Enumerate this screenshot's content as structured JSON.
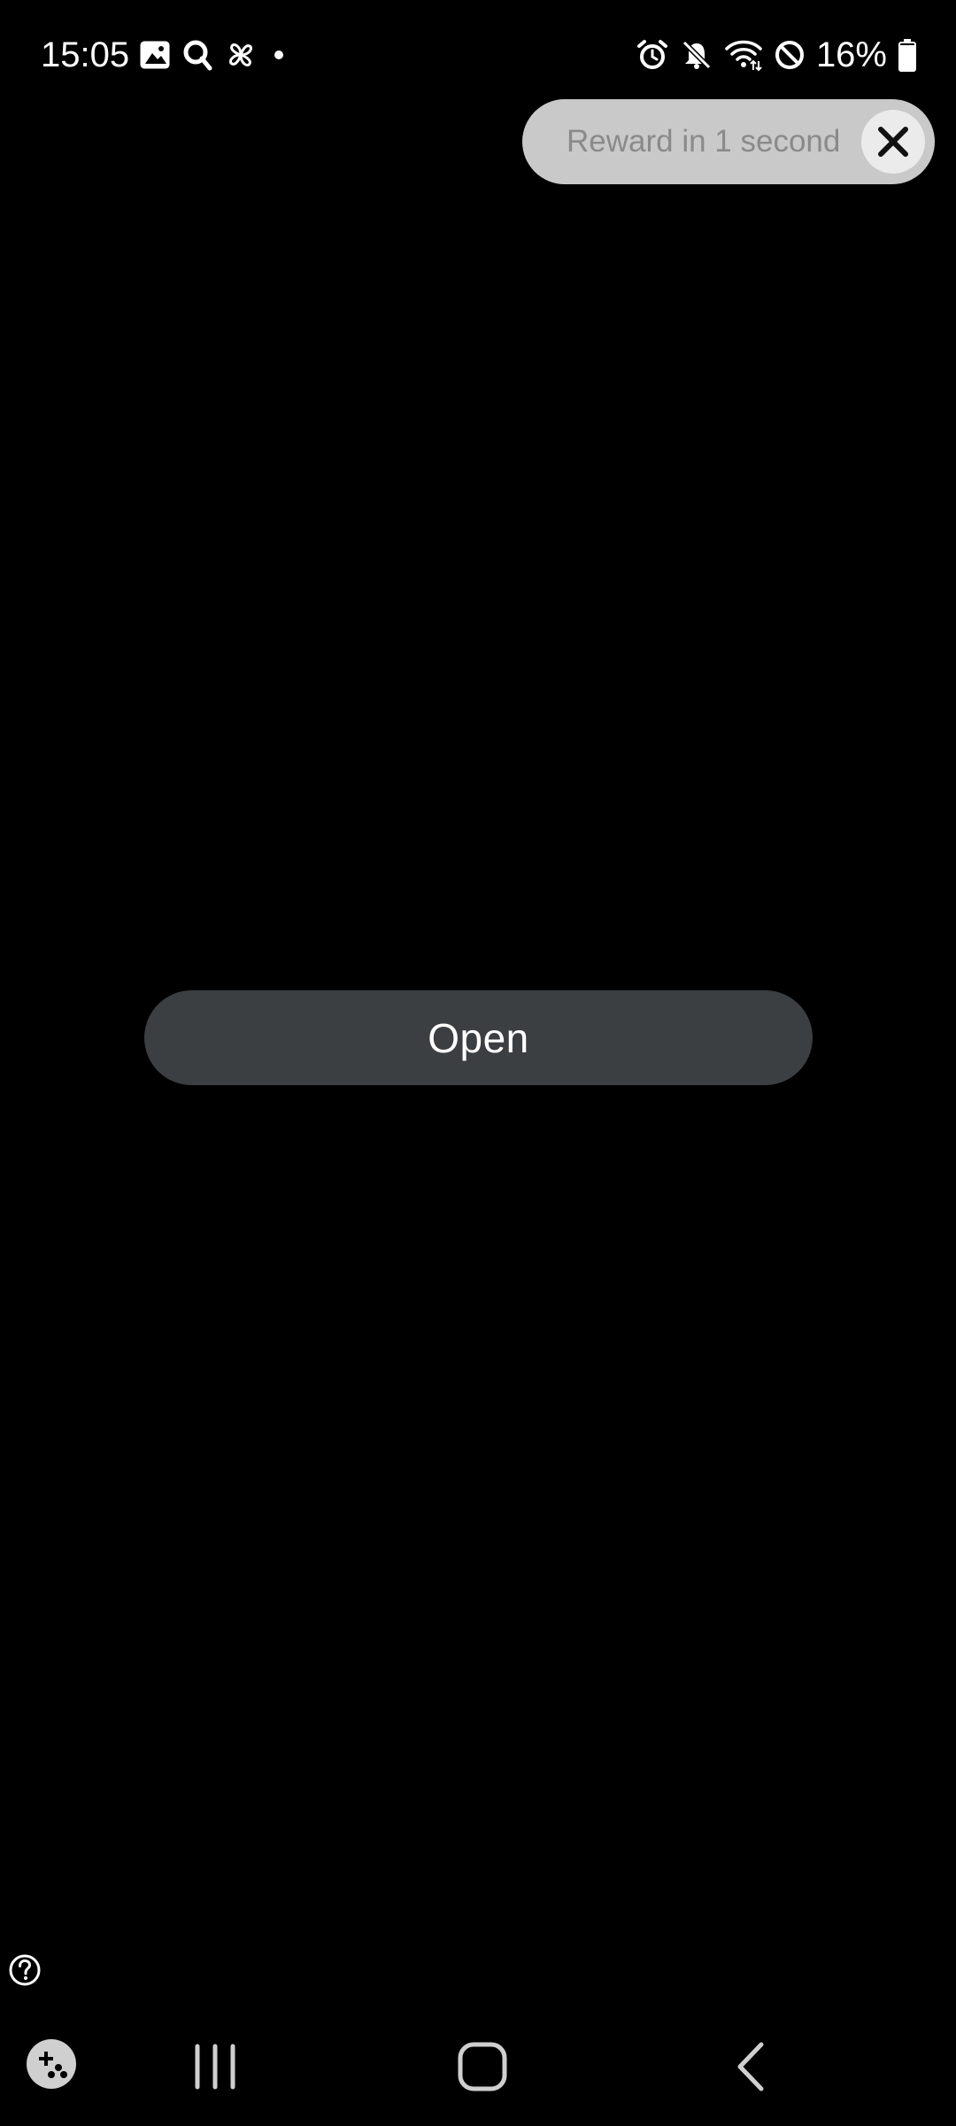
{
  "status_bar": {
    "time": "15:05",
    "left_icons": [
      "gallery-icon",
      "search-app-icon",
      "pinwheel-icon",
      "notification-dot-icon"
    ],
    "right_icons": [
      "alarm-icon",
      "mute-icon",
      "wifi-icon",
      "do-not-disturb-icon",
      "battery-icon"
    ],
    "battery_percent": "16%"
  },
  "reward": {
    "label": "Reward in 1 second",
    "close_icon": "close-icon"
  },
  "main": {
    "open_button_label": "Open"
  },
  "help": {
    "icon": "help-icon"
  },
  "nav_bar": {
    "items": [
      "game-launcher-icon",
      "recents-icon",
      "home-icon",
      "back-icon"
    ]
  },
  "colors": {
    "background": "#000000",
    "button": "#3c3f42",
    "pill": "#c9c9c9",
    "pill_text": "#8a8a8a",
    "icon": "#ffffff"
  }
}
